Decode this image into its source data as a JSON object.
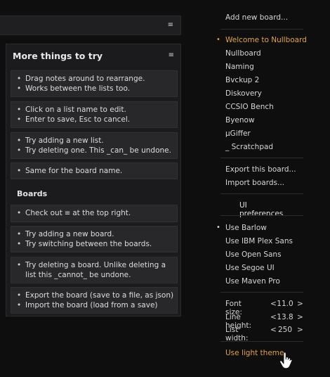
{
  "partial_list": {
    "menu_icon": "≡"
  },
  "list": {
    "title": "More things to try",
    "menu_icon": "≡",
    "notes": [
      {
        "lines": [
          "Drag notes around to rearrange.",
          "Works between the lists too."
        ]
      },
      {
        "lines": [
          "Click on a list name to edit.",
          "Enter to save, Esc to cancel."
        ]
      },
      {
        "lines": [
          "Try adding a new list.",
          "Try deleting one. This  _can_  be undone."
        ]
      },
      {
        "lines": [
          "Same for the board name."
        ]
      }
    ],
    "section": "Boards",
    "notes2": [
      {
        "prefix": "Check out",
        "icon": "≡",
        "suffix": "at the top right."
      },
      {
        "lines": [
          "Try adding a new board.",
          "Try switching between the boards."
        ]
      },
      {
        "lines": [
          "Try deleting a board. Unlike deleting a",
          "list this  _cannot_  be undone."
        ]
      },
      {
        "lines": [
          "Export the board  (save to a file, as json)",
          "Import the board  (load from a save)"
        ]
      }
    ]
  },
  "menu": {
    "add_board": "Add new board...",
    "boards": [
      "Welcome to Nullboard",
      "Nullboard",
      "Naming",
      "Bvckup 2",
      "Diskovery",
      "CCSIO Bench",
      "Byenow",
      "µGiffer",
      "_ Scratchpad"
    ],
    "active_board": "Welcome to Nullboard",
    "export": "Export this board...",
    "import": "Import boards...",
    "prefs_title": "UI preferences",
    "fonts": [
      "Use Barlow",
      "Use IBM Plex Sans",
      "Use Open Sans",
      "Use Segoe UI",
      "Use Maven Pro"
    ],
    "active_font": "Use Barlow",
    "font_size": {
      "label": "Font size:",
      "value": "11.0"
    },
    "line_height": {
      "label": "Line height:",
      "value": "13.8"
    },
    "list_width": {
      "label": "List width:",
      "value": "250"
    },
    "dec": "<",
    "inc": ">",
    "theme": "Use light theme",
    "colors": {
      "accent": "#e0a43a",
      "background": "#0e0e0f",
      "panel": "#1b1b1d",
      "note": "#28282a"
    }
  }
}
